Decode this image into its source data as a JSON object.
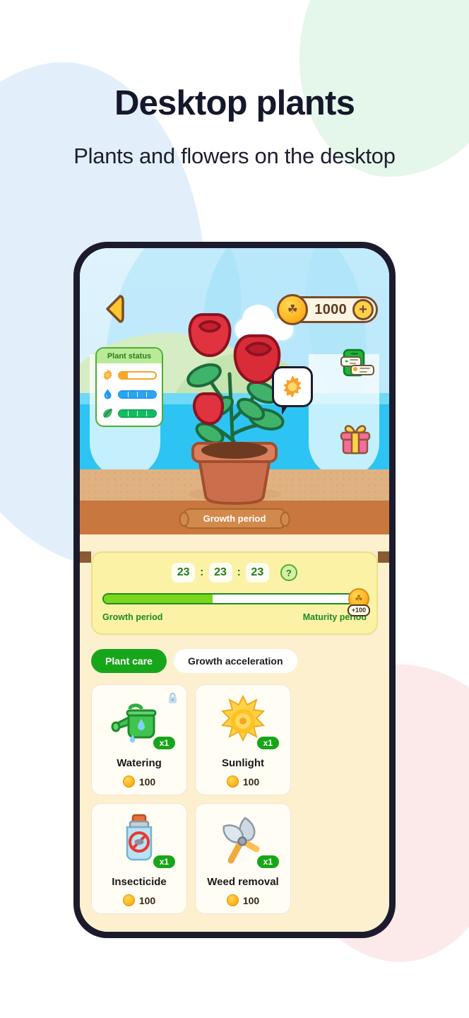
{
  "header": {
    "title": "Desktop plants",
    "subtitle": "Plants and flowers on the desktop"
  },
  "colors": {
    "accent_green": "#17a61a",
    "coin_gold": "#ffb31f",
    "panel_cream": "#fdf0cf",
    "timer_card": "#fbf2a5",
    "phone_frame": "#1c1b2e",
    "blob_blue": "#e2effb",
    "blob_green": "#e4f7ea",
    "blob_pink": "#fce9ea"
  },
  "game": {
    "back_icon": "back-chevron-icon",
    "currency": {
      "coin_icon": "coin-icon",
      "amount": "1000",
      "add_label": "+"
    },
    "plant_status": {
      "title": "Plant status",
      "rows": [
        {
          "icon": "sun-icon",
          "segments": 4,
          "filled": 1
        },
        {
          "icon": "water-drop-icon",
          "segments": 4,
          "filled": 4
        },
        {
          "icon": "leaf-icon",
          "segments": 4,
          "filled": 4
        }
      ]
    },
    "bubble_icon": "sun-icon",
    "tasks_icon": "tasks-board-icon",
    "gift_icon": "gift-box-icon",
    "plant_icon": "rose-plant-in-pot",
    "stage_banner": "Growth period"
  },
  "timer": {
    "hours": "23",
    "minutes": "23",
    "seconds": "23",
    "separator": ":",
    "help_label": "?",
    "progress_percent": 42,
    "reward_coin_label": "+100",
    "start_label": "Growth period",
    "end_label": "Maturity period"
  },
  "tabs": [
    {
      "label": "Plant care",
      "active": true
    },
    {
      "label": "Growth acceleration",
      "active": false
    }
  ],
  "items": [
    {
      "name": "Watering",
      "icon": "watering-can-icon",
      "qty": "x1",
      "price": "100",
      "locked": true
    },
    {
      "name": "Sunlight",
      "icon": "sun-icon",
      "qty": "x1",
      "price": "100",
      "locked": false
    },
    {
      "name": "Insecticide",
      "icon": "insecticide-icon",
      "qty": "x1",
      "price": "100",
      "locked": false
    },
    {
      "name": "Weed removal",
      "icon": "shears-icon",
      "qty": "x1",
      "price": "100",
      "locked": false
    }
  ]
}
